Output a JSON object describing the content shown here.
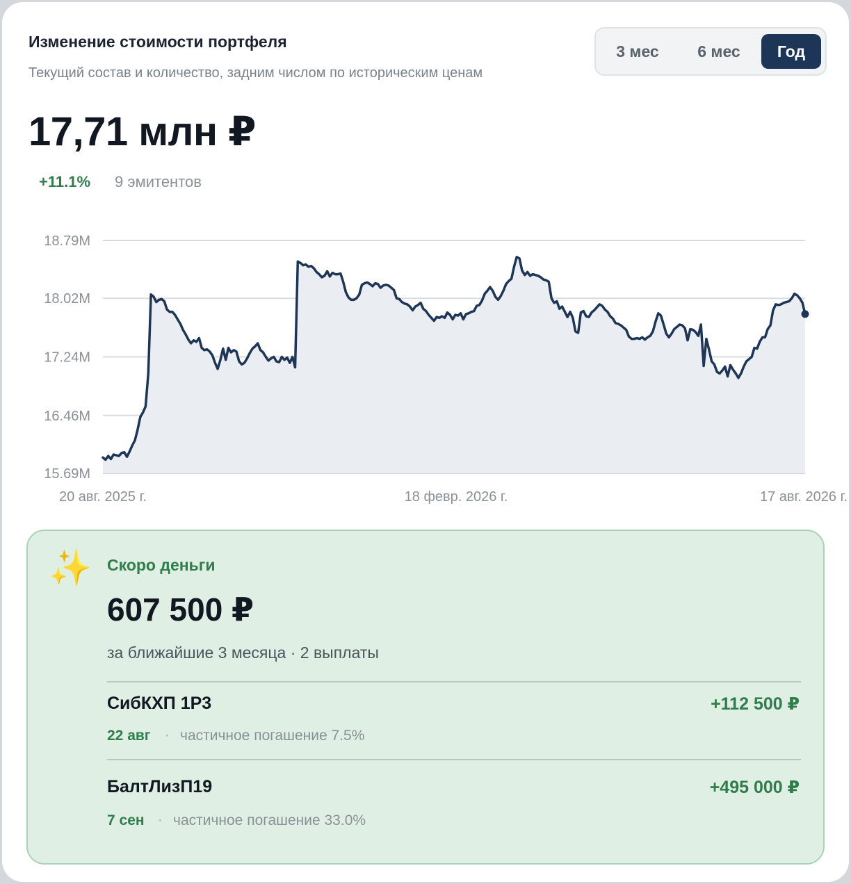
{
  "header": {
    "title": "Изменение стоимости портфеля",
    "subtitle": "Текущий состав и количество, задним числом по историческим ценам"
  },
  "period_switch": {
    "options": [
      "3 мес",
      "6 мес",
      "Год"
    ],
    "selected": "Год"
  },
  "summary": {
    "value": "17,71 млн ₽",
    "change": "+11.1%",
    "issuers": "9 эмитентов"
  },
  "colors": {
    "line": "#1d3557",
    "area": "#eaedf1",
    "positive": "#2e7d4a",
    "accent": "#1d3557"
  },
  "chart_data": {
    "type": "area",
    "y_tick_labels": [
      "18.79M",
      "18.02M",
      "17.24M",
      "16.46M",
      "15.69M"
    ],
    "y_ticks": [
      18.79,
      18.02,
      17.24,
      16.46,
      15.69
    ],
    "ylim": [
      15.69,
      18.79
    ],
    "x_tick_labels": [
      "20 авг. 2025 г.",
      "18 февр. 2026 г.",
      "17 авг. 2026 г."
    ],
    "grid": true,
    "x_start": "2025-08-20",
    "x_end": "2026-08-17",
    "series": [
      {
        "values": [
          15.9,
          15.87,
          15.92,
          15.88,
          15.94,
          15.93,
          15.92,
          15.96,
          15.97,
          15.91,
          15.98,
          16.06,
          16.13,
          16.27,
          16.44,
          16.5,
          16.58,
          17.02,
          18.07,
          18.04,
          17.97,
          18.0,
          18.01,
          17.98,
          17.87,
          17.84,
          17.84,
          17.8,
          17.74,
          17.68,
          17.6,
          17.54,
          17.47,
          17.42,
          17.46,
          17.44,
          17.49,
          17.36,
          17.33,
          17.34,
          17.31,
          17.26,
          17.16,
          17.08,
          17.2,
          17.35,
          17.2,
          17.36,
          17.3,
          17.33,
          17.31,
          17.18,
          17.14,
          17.16,
          17.22,
          17.29,
          17.35,
          17.38,
          17.42,
          17.33,
          17.3,
          17.24,
          17.19,
          17.22,
          17.24,
          17.18,
          17.17,
          17.24,
          17.2,
          17.23,
          17.16,
          17.24,
          17.1,
          18.51,
          18.49,
          18.46,
          18.47,
          18.44,
          18.45,
          18.42,
          18.37,
          18.34,
          18.3,
          18.32,
          18.38,
          18.31,
          18.36,
          18.34,
          18.34,
          18.35,
          18.24,
          18.1,
          18.03,
          18.0,
          18.0,
          18.02,
          18.07,
          18.2,
          18.22,
          18.23,
          18.21,
          18.18,
          18.22,
          18.21,
          18.16,
          18.19,
          18.2,
          18.19,
          18.16,
          18.13,
          18.02,
          18.01,
          17.97,
          17.95,
          17.94,
          17.91,
          17.86,
          17.91,
          17.93,
          17.96,
          17.88,
          17.85,
          17.8,
          17.76,
          17.72,
          17.77,
          17.76,
          17.78,
          17.76,
          17.83,
          17.8,
          17.74,
          17.8,
          17.79,
          17.82,
          17.74,
          17.81,
          17.82,
          17.84,
          17.85,
          17.92,
          17.93,
          17.99,
          18.08,
          18.12,
          18.17,
          18.12,
          18.04,
          18.0,
          18.05,
          18.12,
          18.21,
          18.25,
          18.28,
          18.44,
          18.57,
          18.55,
          18.39,
          18.33,
          18.37,
          18.32,
          18.34,
          18.33,
          18.32,
          18.3,
          18.27,
          18.26,
          18.24,
          18.02,
          17.96,
          17.98,
          17.88,
          17.91,
          17.84,
          17.77,
          17.84,
          17.76,
          17.58,
          17.56,
          17.83,
          17.85,
          17.78,
          17.77,
          17.83,
          17.86,
          17.9,
          17.94,
          17.92,
          17.87,
          17.84,
          17.78,
          17.75,
          17.69,
          17.68,
          17.66,
          17.63,
          17.6,
          17.51,
          17.48,
          17.48,
          17.49,
          17.48,
          17.5,
          17.47,
          17.5,
          17.52,
          17.58,
          17.71,
          17.82,
          17.79,
          17.67,
          17.55,
          17.5,
          17.55,
          17.61,
          17.64,
          17.67,
          17.66,
          17.62,
          17.46,
          17.61,
          17.6,
          17.57,
          17.52,
          17.67,
          17.12,
          17.48,
          17.34,
          17.18,
          17.14,
          17.04,
          17.02,
          17.06,
          17.11,
          16.98,
          17.13,
          17.07,
          17.02,
          16.96,
          17.02,
          17.11,
          17.18,
          17.21,
          17.24,
          17.36,
          17.35,
          17.44,
          17.5,
          17.5,
          17.61,
          17.66,
          17.86,
          17.94,
          17.93,
          17.94,
          17.96,
          17.97,
          17.98,
          18.02,
          18.08,
          18.06,
          18.02,
          17.96,
          17.81
        ]
      }
    ]
  },
  "soon_money": {
    "label": "Скоро деньги",
    "amount": "607 500 ₽",
    "note": "за ближайшие 3 месяца · 2 выплаты",
    "icon": "sparkles-icon",
    "payments": [
      {
        "name": "СибКХП 1Р3",
        "amount": "+112 500 ₽",
        "date": "22 авг",
        "separator": "·",
        "description": "частичное погашение 7.5%"
      },
      {
        "name": "БалтЛизП19",
        "amount": "+495 000 ₽",
        "date": "7 сен",
        "separator": "·",
        "description": "частичное погашение 33.0%"
      }
    ]
  }
}
